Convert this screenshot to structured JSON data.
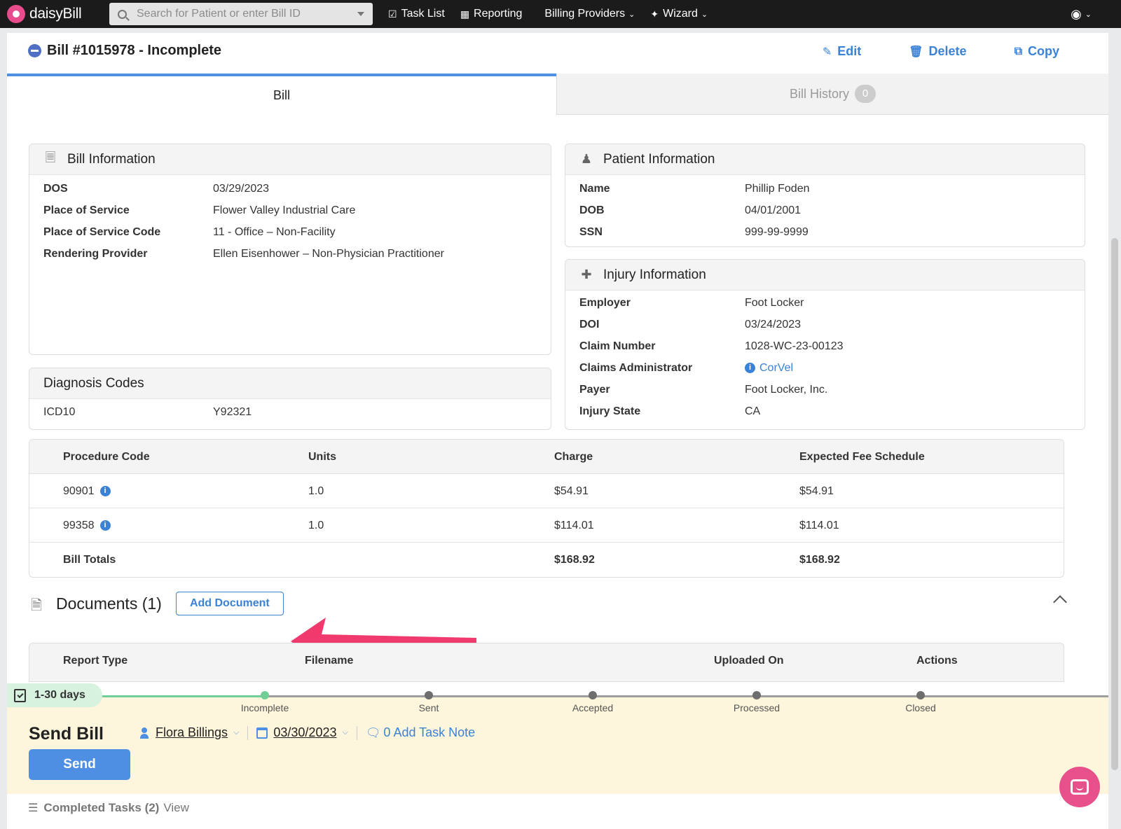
{
  "nav": {
    "brand": "daisyBill",
    "search_placeholder": "Search for Patient or enter Bill ID",
    "items": [
      "Task List",
      "Reporting",
      "Billing Providers",
      "Wizard"
    ]
  },
  "bill": {
    "title": "Bill #1015978 - Incomplete",
    "actions": {
      "edit": "Edit",
      "delete": "Delete",
      "copy": "Copy"
    }
  },
  "tabs": {
    "bill": "Bill",
    "history": "Bill History",
    "history_count": "0"
  },
  "bill_info": {
    "title": "Bill Information",
    "rows": [
      {
        "label": "DOS",
        "value": "03/29/2023"
      },
      {
        "label": "Place of Service",
        "value": "Flower Valley Industrial Care"
      },
      {
        "label": "Place of Service Code",
        "value": "11 - Office – Non-Facility"
      },
      {
        "label": "Rendering Provider",
        "value": "Ellen Eisenhower – Non-Physician Practitioner"
      }
    ]
  },
  "patient_info": {
    "title": "Patient Information",
    "rows": [
      {
        "label": "Name",
        "value": "Phillip Foden"
      },
      {
        "label": "DOB",
        "value": "04/01/2001"
      },
      {
        "label": "SSN",
        "value": "999-99-9999"
      }
    ]
  },
  "injury_info": {
    "title": "Injury Information",
    "rows": [
      {
        "label": "Employer",
        "value": "Foot Locker"
      },
      {
        "label": "DOI",
        "value": "03/24/2023"
      },
      {
        "label": "Claim Number",
        "value": "1028-WC-23-00123"
      },
      {
        "label": "Claims Administrator",
        "value": "CorVel"
      },
      {
        "label": "Payer",
        "value": "Foot Locker, Inc."
      },
      {
        "label": "Injury State",
        "value": "CA"
      }
    ]
  },
  "diagnosis": {
    "title": "Diagnosis Codes",
    "label": "ICD10",
    "value": "Y92321"
  },
  "procedures": {
    "headers": [
      "Procedure Code",
      "Units",
      "Charge",
      "Expected Fee Schedule"
    ],
    "rows": [
      {
        "code": "90901",
        "units": "1.0",
        "charge": "$54.91",
        "fee": "$54.91"
      },
      {
        "code": "99358",
        "units": "1.0",
        "charge": "$114.01",
        "fee": "$114.01"
      }
    ],
    "totals": {
      "label": "Bill Totals",
      "charge": "$168.92",
      "fee": "$168.92"
    }
  },
  "documents": {
    "title": "Documents (1)",
    "add_label": "Add Document",
    "headers": [
      "Report Type",
      "Filename",
      "Uploaded On",
      "Actions"
    ]
  },
  "task": {
    "days": "1-30 days",
    "stages": [
      "Incomplete",
      "Sent",
      "Accepted",
      "Processed",
      "Closed"
    ],
    "title": "Send Bill",
    "assignee": "Flora Billings",
    "date": "03/30/2023",
    "note": "0 Add Task Note",
    "send_label": "Send",
    "completed_label": "Completed Tasks (2)",
    "completed_view": "View"
  },
  "colors": {
    "accent": "#3b82d6",
    "arrow": "#f03a6e",
    "task_bg": "#fdf6dc",
    "brand_pink": "#e94c8c"
  }
}
